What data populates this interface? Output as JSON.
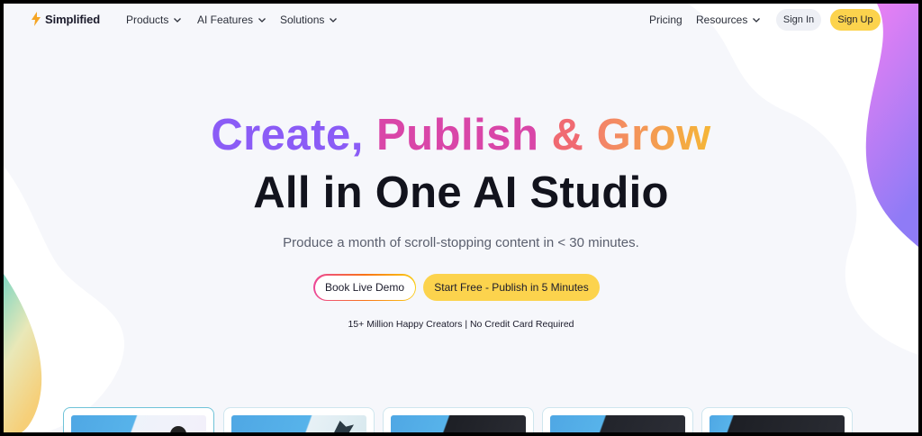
{
  "brand": {
    "name": "Simplified"
  },
  "nav": {
    "left": [
      {
        "label": "Products"
      },
      {
        "label": "AI Features"
      },
      {
        "label": "Solutions"
      }
    ],
    "pricing": "Pricing",
    "resources": "Resources",
    "sign_in": "Sign In",
    "sign_up": "Sign Up"
  },
  "hero": {
    "line1": {
      "create": "Create,",
      "publish": "Publish",
      "amp": "&",
      "grow": "Grow"
    },
    "line2": "All in One AI Studio",
    "subtitle": "Produce a month of scroll-stopping content in < 30 minutes.",
    "demo_button": "Book Live Demo",
    "start_button": "Start Free - Publish in 5 Minutes",
    "trust_line": "15+ Million Happy Creators | No Credit Card Required"
  },
  "colors": {
    "accent_yellow": "#fcd34d",
    "headline_purple": "#8b5cf6",
    "headline_pink": "#d946a8",
    "headline_orange": "#f3826a",
    "headline_dark": "#12131d"
  },
  "icons": [
    "logo-bolt-icon",
    "chevron-down-icon"
  ]
}
